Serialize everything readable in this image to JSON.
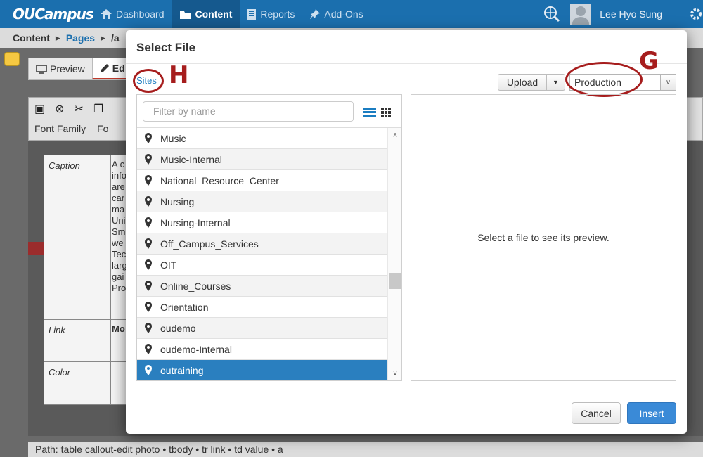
{
  "app": {
    "logo": "OUCampus",
    "nav": [
      "Dashboard",
      "Content",
      "Reports",
      "Add-Ons"
    ],
    "active_nav": "Content",
    "user": "Lee Hyo Sung"
  },
  "breadcrumb": {
    "root": "Content",
    "pages": "Pages",
    "rest": "/a"
  },
  "edit_modes": {
    "preview": "Preview",
    "edit": "Ed"
  },
  "editor": {
    "font_family": "Font Family",
    "font_size": "Fo",
    "caption_label": "Caption",
    "caption_lines": [
      "A c",
      "info",
      "are",
      "car",
      "ma",
      "Uni",
      "Sm",
      "we",
      "Tec",
      "larg",
      "gai",
      "Pro"
    ],
    "link_label": "Link",
    "link_value": "Mo",
    "color_label": "Color",
    "path": "Path:  table callout-edit photo • tbody • tr link • td value • a"
  },
  "modal": {
    "title": "Select File",
    "sites_link": "Sites",
    "upload_label": "Upload",
    "environment": "Production",
    "filter_placeholder": "Filter by name",
    "preview_message": "Select a file to see its preview.",
    "cancel_label": "Cancel",
    "insert_label": "Insert",
    "sites": [
      "Music",
      "Music-Internal",
      "National_Resource_Center",
      "Nursing",
      "Nursing-Internal",
      "Off_Campus_Services",
      "OIT",
      "Online_Courses",
      "Orientation",
      "oudemo",
      "oudemo-Internal",
      "outraining"
    ],
    "selected_site": "outraining"
  },
  "annotations": {
    "sites_marker": "H",
    "environment_marker": "G"
  },
  "colors": {
    "accent": "#1b6fae",
    "selection": "#2a7fbf",
    "annotation": "#a61d1d",
    "insert_button": "#3a8ad7"
  }
}
